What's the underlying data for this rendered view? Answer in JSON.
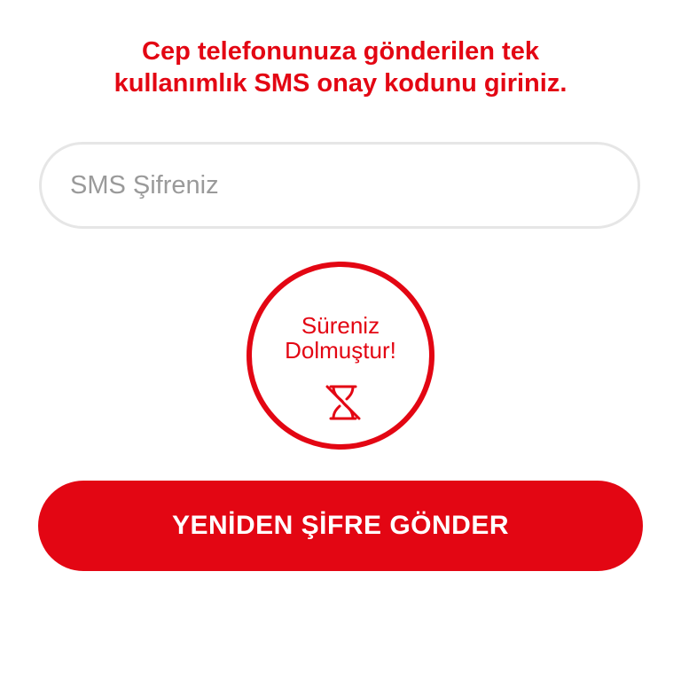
{
  "instruction": {
    "line1": "Cep telefonunuza gönderilen tek",
    "line2": "kullanımlık SMS onay kodunu giriniz."
  },
  "sms_input": {
    "placeholder": "SMS Şifreniz",
    "value": ""
  },
  "timer": {
    "line1": "Süreniz",
    "line2": "Dolmuştur!",
    "icon": "hourglass-expired-icon"
  },
  "resend_button": {
    "label": "YENİDEN ŞİFRE GÖNDER"
  },
  "colors": {
    "brand_red": "#e30613",
    "input_border": "#e6e6e6",
    "placeholder": "#9a9a9a"
  }
}
